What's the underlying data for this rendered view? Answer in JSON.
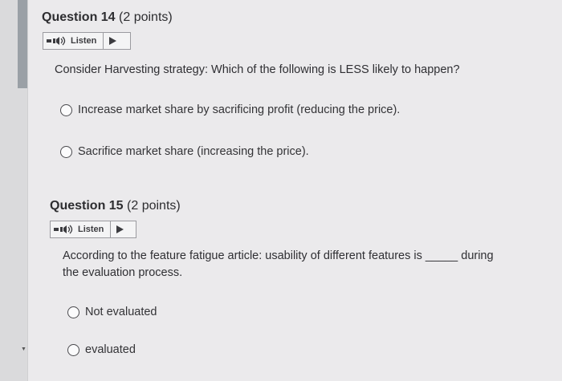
{
  "q14": {
    "number_label": "Question 14",
    "points_label": "(2 points)",
    "listen_label": "Listen",
    "stem": "Consider Harvesting strategy: Which of the following is LESS likely to happen?",
    "options": [
      "Increase market share by sacrificing profit (reducing the price).",
      "Sacrifice market share (increasing the price)."
    ]
  },
  "q15": {
    "number_label": "Question 15",
    "points_label": "(2 points)",
    "listen_label": "Listen",
    "stem_line1": "According to the feature fatigue article: usability of different features is _____ during",
    "stem_line2": "the evaluation process.",
    "options": [
      "Not evaluated",
      "evaluated"
    ]
  },
  "icons": {
    "speaker": "speaker-icon",
    "play": "play-icon",
    "scroll_down": "scroll-down-arrow-icon"
  }
}
